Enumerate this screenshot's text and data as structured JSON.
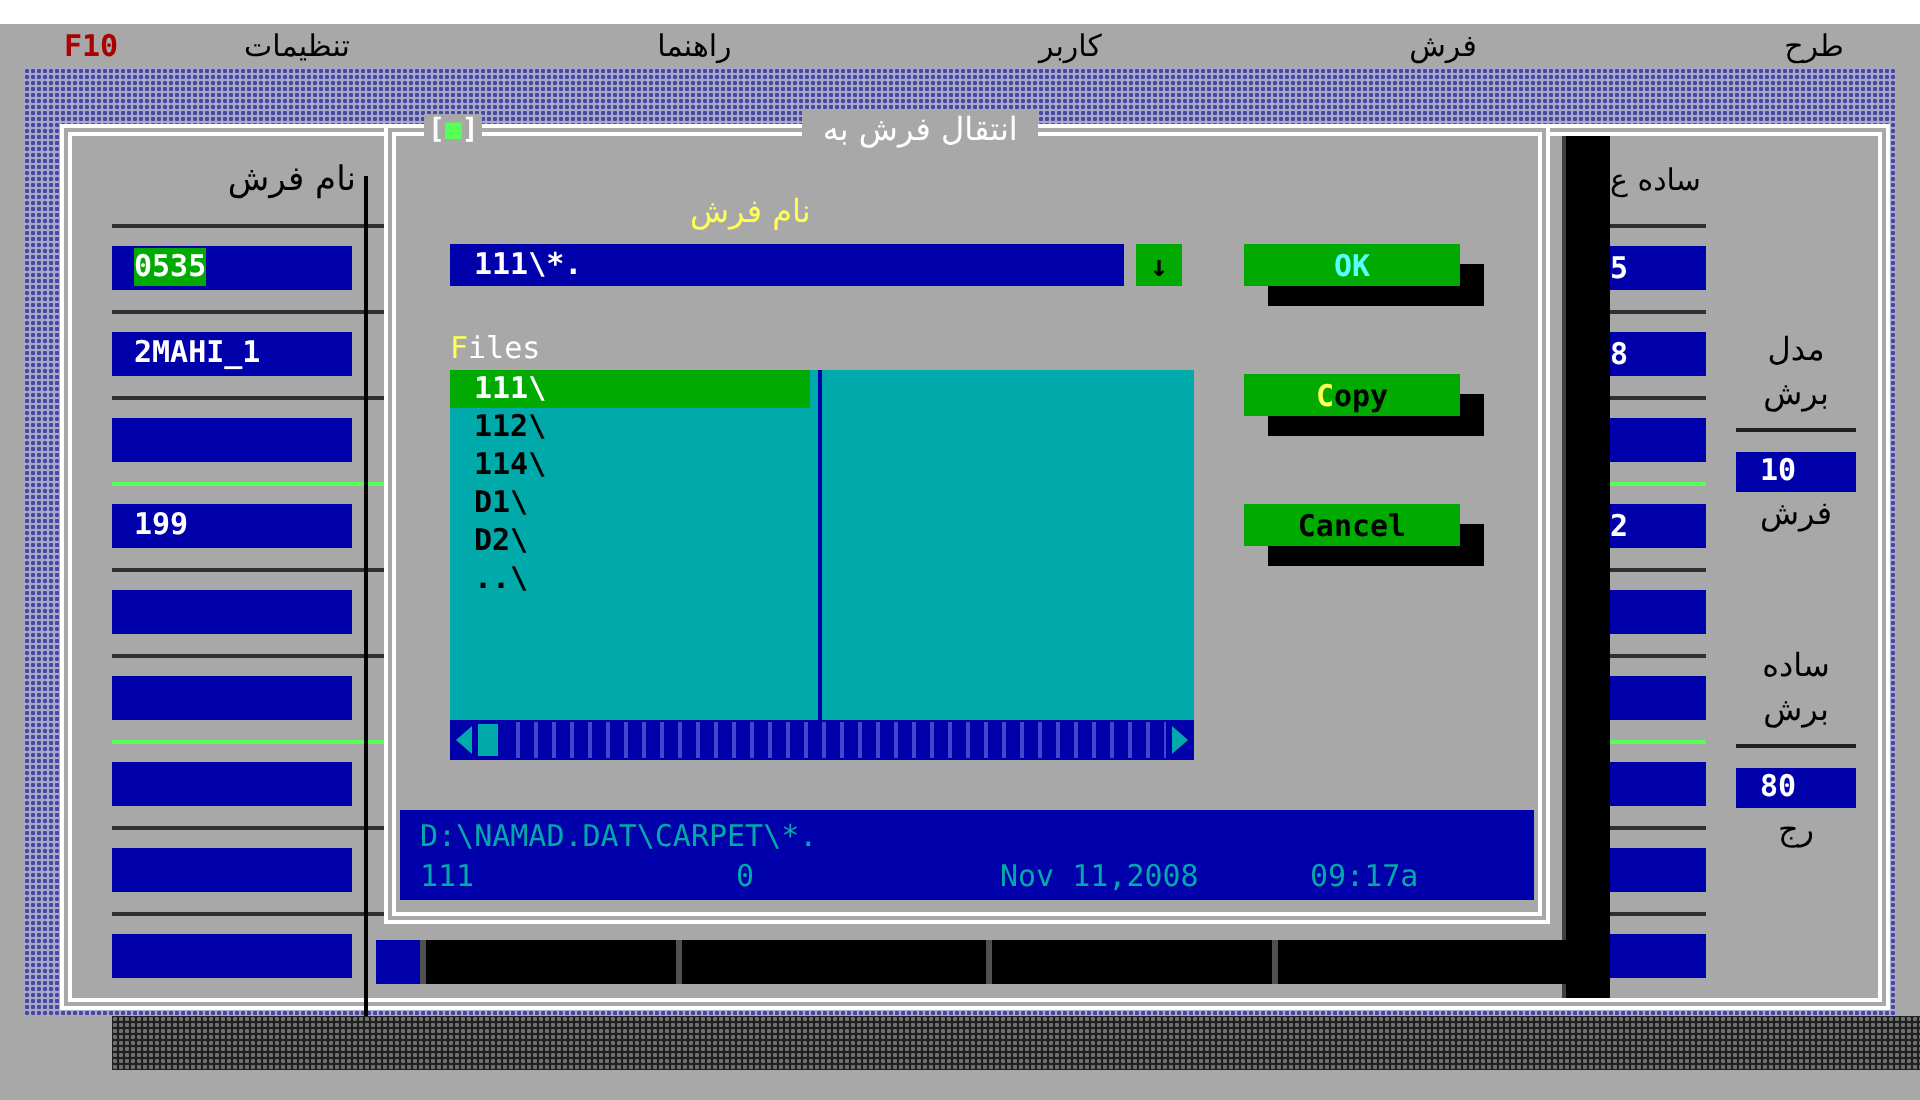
{
  "menu_bar": {
    "hotkey": "F10",
    "items": [
      "طرح",
      "فرش",
      "کاربر",
      "راهنما",
      "تنظیمات"
    ]
  },
  "main_window": {
    "left_header": "نام فرش",
    "right_header": "ساده ع",
    "rows": [
      {
        "name": "0535",
        "value": "5",
        "selected": true,
        "marker": false
      },
      {
        "name": "2MAHI_1",
        "value": "8",
        "selected": false,
        "marker": false
      },
      {
        "name": "",
        "value": "",
        "selected": false,
        "marker": false
      },
      {
        "name": "199",
        "value": "2",
        "selected": false,
        "marker": true
      },
      {
        "name": "",
        "value": "",
        "selected": false,
        "marker": false
      },
      {
        "name": "",
        "value": "",
        "selected": false,
        "marker": false
      },
      {
        "name": "",
        "value": "",
        "selected": false,
        "marker": true
      },
      {
        "name": "",
        "value": "",
        "selected": false,
        "marker": false
      },
      {
        "name": "",
        "value": "",
        "selected": false,
        "marker": false
      }
    ],
    "side_groups": [
      {
        "labels": [
          "مدل",
          "برش"
        ],
        "value": "10",
        "caption": "فرش"
      },
      {
        "labels": [
          "ساده",
          "برش"
        ],
        "value": "80",
        "caption": "رج"
      }
    ]
  },
  "dialog": {
    "title": "انتقال فرش به",
    "close_button": "[■]",
    "name_label": "نام فرش",
    "name_value": "111\\*.",
    "dropdown": "↓",
    "files_label": {
      "text": "Files",
      "hotkey": true
    },
    "files": [
      {
        "name": "111\\",
        "selected": true
      },
      {
        "name": "112\\",
        "selected": false
      },
      {
        "name": "114\\",
        "selected": false
      },
      {
        "name": "D1\\",
        "selected": false
      },
      {
        "name": "D2\\",
        "selected": false
      },
      {
        "name": "..\\",
        "selected": false
      }
    ],
    "buttons": [
      {
        "label": "OK",
        "focused": true,
        "hotkey": false
      },
      {
        "label": "Copy",
        "focused": false,
        "hotkey": true
      },
      {
        "label": "Cancel",
        "focused": false,
        "hotkey": false
      }
    ],
    "status": {
      "path": "D:\\NAMAD.DAT\\CARPET\\*.",
      "name": "111",
      "size": "0",
      "date": "Nov 11,2008",
      "time": "09:17a"
    }
  }
}
